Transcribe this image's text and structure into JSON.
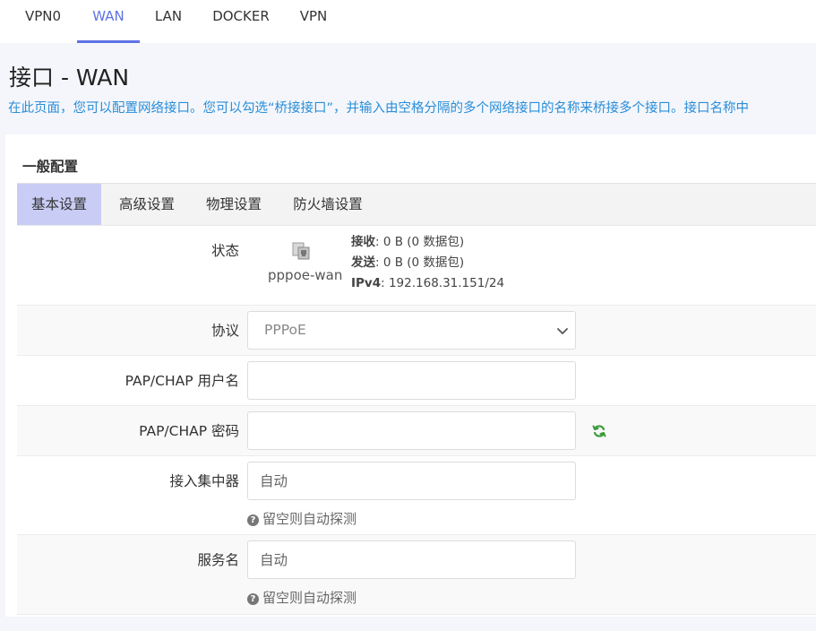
{
  "topnav": {
    "tabs": [
      {
        "label": "VPN0",
        "active": false
      },
      {
        "label": "WAN",
        "active": true
      },
      {
        "label": "LAN",
        "active": false
      },
      {
        "label": "DOCKER",
        "active": false
      },
      {
        "label": "VPN",
        "active": false
      }
    ]
  },
  "header": {
    "title": "接口 - WAN",
    "description": "在此页面，您可以配置网络接口。您可以勾选“桥接接口”，并输入由空格分隔的多个网络接口的名称来桥接多个接口。接口名称中"
  },
  "section": {
    "title": "一般配置",
    "subtabs": [
      {
        "label": "基本设置",
        "active": true
      },
      {
        "label": "高级设置",
        "active": false
      },
      {
        "label": "物理设置",
        "active": false
      },
      {
        "label": "防火墙设置",
        "active": false
      }
    ]
  },
  "status": {
    "label": "状态",
    "interface_name": "pppoe-wan",
    "icon": "ethernet-port-icon",
    "rx_label": "接收",
    "rx_value": ": 0 B (0 数据包)",
    "tx_label": "发送",
    "tx_value": ": 0 B (0 数据包)",
    "ipv4_label": "IPv4",
    "ipv4_value": ": 192.168.31.151/24"
  },
  "protocol": {
    "label": "协议",
    "selected": "PPPoE"
  },
  "username": {
    "label": "PAP/CHAP 用户名",
    "value": ""
  },
  "password": {
    "label": "PAP/CHAP 密码",
    "value": "",
    "reveal_icon": "refresh-icon"
  },
  "concentrator": {
    "label": "接入集中器",
    "placeholder": "自动",
    "help": "留空则自动探测"
  },
  "service": {
    "label": "服务名",
    "placeholder": "自动",
    "help": "留空则自动探测"
  },
  "colors": {
    "accent": "#5e72e4",
    "description": "#2a8ed8",
    "active_subtab": "#c9cdf6",
    "refresh_icon": "#3a9a3a"
  }
}
